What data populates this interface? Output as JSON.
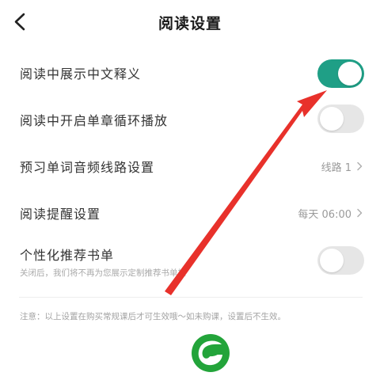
{
  "header": {
    "title": "阅读设置",
    "back_icon": "chevron-left-icon"
  },
  "settings": [
    {
      "label": "阅读中展示中文释义",
      "toggle": "on"
    },
    {
      "label": "阅读中开启单章循环播放",
      "toggle": "off"
    },
    {
      "label": "预习单词音频线路设置",
      "value": "线路 1"
    },
    {
      "label": "阅读提醒设置",
      "value": "每天 06:00"
    },
    {
      "label": "个性化推荐书单",
      "sub": "关闭后，我们将不再为您展示定制推荐书单栏",
      "toggle": "off"
    }
  ],
  "note": "注意：以上设置在购买常规课后才可生效哦～如未购课，设置后不生效。",
  "colors": {
    "toggle_on": "#1f9f86",
    "toggle_off": "#e6e6e6",
    "annotation_arrow": "#e8312b",
    "logo_green": "#23a43a"
  },
  "icons": {
    "annotation": "red-arrow-icon",
    "logo": "green-leaf-logo-icon"
  }
}
